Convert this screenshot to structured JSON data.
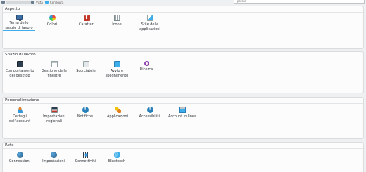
{
  "toolbar": {
    "items": [
      {
        "icon": "arrow-icon",
        "label": ""
      },
      {
        "icon": "list-icon",
        "label": "Vista"
      },
      {
        "icon": "settings-icon",
        "label": "Configura"
      }
    ],
    "search_value": "parola"
  },
  "sections": [
    {
      "title": "Aspetto",
      "items": [
        {
          "label": "Tema dello\nspazio di lavoro",
          "icon": "monitor-icon"
        },
        {
          "label": "Colori",
          "icon": "palette-icon"
        },
        {
          "label": "Caratteri",
          "icon": "font-icon"
        },
        {
          "label": "Icone",
          "icon": "grid-icon"
        },
        {
          "label": "Stile delle\napplicazioni",
          "icon": "style-icon"
        }
      ]
    },
    {
      "title": "Spazio di lavoro",
      "items": [
        {
          "label": "Comportamento\ndel desktop",
          "icon": "desktop-icon"
        },
        {
          "label": "Gestione delle\nfinestre",
          "icon": "window-icon"
        },
        {
          "label": "Scorciatoie",
          "icon": "keyboard-icon"
        },
        {
          "label": "Avvio e\nspegnimento",
          "icon": "power-icon"
        },
        {
          "label": "Ricerca",
          "icon": "search-icon"
        }
      ]
    },
    {
      "title": "Personalizzazione",
      "items": [
        {
          "label": "Dettagli\ndell'account",
          "icon": "user-icon"
        },
        {
          "label": "Impostazioni\nregionali",
          "icon": "flag-icon"
        },
        {
          "label": "Notifiche",
          "icon": "info-icon"
        },
        {
          "label": "Applicazioni",
          "icon": "apps-icon"
        },
        {
          "label": "Accessibilità",
          "icon": "accessibility-icon"
        },
        {
          "label": "Account in linea",
          "icon": "online-accounts-icon"
        }
      ]
    },
    {
      "title": "Rete",
      "items": [
        {
          "label": "Connessioni",
          "icon": "globe-icon"
        },
        {
          "label": "Impostazioni",
          "icon": "globe-settings-icon"
        },
        {
          "label": "Connettività",
          "icon": "network-icon"
        },
        {
          "label": "Bluetooth",
          "icon": "bluetooth-icon"
        }
      ]
    }
  ]
}
